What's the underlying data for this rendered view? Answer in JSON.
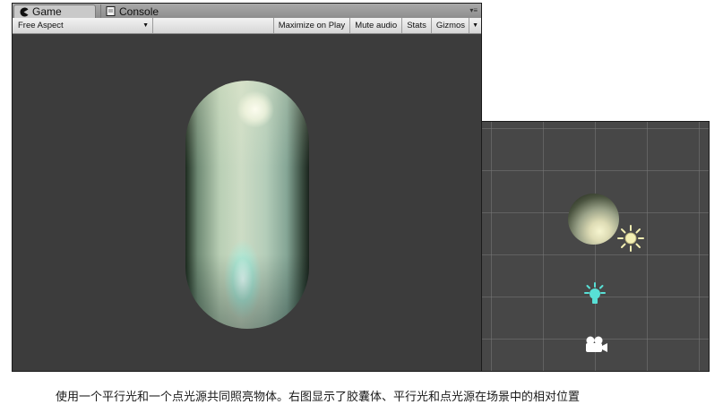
{
  "game_window": {
    "tabs": [
      {
        "label": "Game",
        "icon": "pacman-icon",
        "active": true
      },
      {
        "label": "Console",
        "icon": "console-icon",
        "active": false
      }
    ],
    "toolbar": {
      "aspect_label": "Free Aspect",
      "maximize_label": "Maximize on Play",
      "mute_label": "Mute audio",
      "stats_label": "Stats",
      "gizmos_label": "Gizmos"
    }
  },
  "scene_view": {
    "icons": [
      "directional-light-icon",
      "point-light-icon",
      "camera-icon"
    ]
  },
  "colors": {
    "viewport_bg": "#3c3c3c",
    "scene_bg": "#474747",
    "directional_light": "#f3efb3",
    "point_light": "#58e0d6"
  },
  "caption": "使用一个平行光和一个点光源共同照亮物体。右图显示了胶囊体、平行光和点光源在场景中的相对位置"
}
